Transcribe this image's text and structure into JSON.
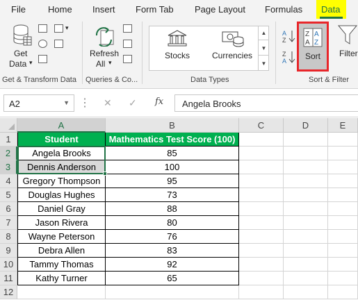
{
  "tabs": [
    "File",
    "Home",
    "Insert",
    "Form Tab",
    "Page Layout",
    "Formulas",
    "Data"
  ],
  "active_tab": "Data",
  "ribbon": {
    "get_data": {
      "line1": "Get",
      "line2": "Data"
    },
    "refresh_all": {
      "line1": "Refresh",
      "line2": "All"
    },
    "stocks": "Stocks",
    "currencies": "Currencies",
    "sort": "Sort",
    "filter": "Filter",
    "groups": {
      "get_transform": "Get & Transform Data",
      "queries": "Queries & Co...",
      "data_types": "Data Types",
      "sort_filter": "Sort & Filter"
    }
  },
  "formula_bar": {
    "name_box": "A2",
    "fx": "fx",
    "value": "Angela Brooks"
  },
  "columns": [
    "A",
    "B",
    "C",
    "D",
    "E"
  ],
  "rows": [
    "1",
    "2",
    "3",
    "4",
    "5",
    "6",
    "7",
    "8",
    "9",
    "10",
    "11",
    "12"
  ],
  "table": {
    "headers": [
      "Student",
      "Mathematics Test Score (100)"
    ],
    "records": [
      [
        "Angela Brooks",
        "85"
      ],
      [
        "Dennis Anderson",
        "100"
      ],
      [
        "Gregory Thompson",
        "95"
      ],
      [
        "Douglas Hughes",
        "73"
      ],
      [
        "Daniel Gray",
        "88"
      ],
      [
        "Jason Rivera",
        "80"
      ],
      [
        "Wayne Peterson",
        "76"
      ],
      [
        "Debra Allen",
        "83"
      ],
      [
        "Tammy Thomas",
        "92"
      ],
      [
        "Kathy Turner",
        "65"
      ]
    ]
  },
  "colors": {
    "accent": "#217346",
    "header_fill": "#00b050",
    "highlight_tab": "#ffff00",
    "sort_outline": "#e8262a"
  }
}
